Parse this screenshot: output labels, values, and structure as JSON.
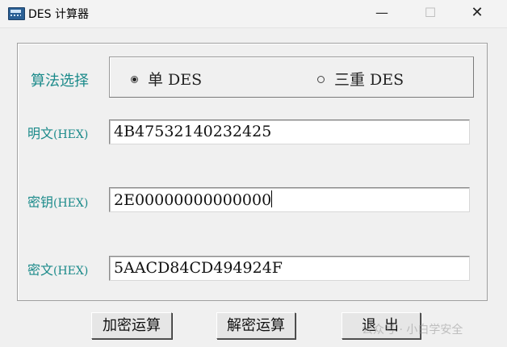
{
  "window": {
    "title": "DES 计算器",
    "minimize_icon": "—",
    "maximize_icon": "☐",
    "close_icon": "✕"
  },
  "algorithm": {
    "label": "算法选择",
    "options": [
      "单 DES",
      "三重 DES"
    ],
    "selected": "单 DES"
  },
  "fields": {
    "plaintext_label_cn": "明文",
    "plaintext_label_hex": "(HEX)",
    "plaintext_value": "4B47532140232425",
    "key_label_cn": "密钥",
    "key_label_hex": "(HEX)",
    "key_value": "2E00000000000000",
    "ciphertext_label_cn": "密文",
    "ciphertext_label_hex": "(HEX)",
    "ciphertext_value": "5AACD84CD494924F"
  },
  "buttons": {
    "encrypt": "加密运算",
    "decrypt": "解密运算",
    "exit": "退 出"
  },
  "watermark": "公众号 · 小白学安全"
}
